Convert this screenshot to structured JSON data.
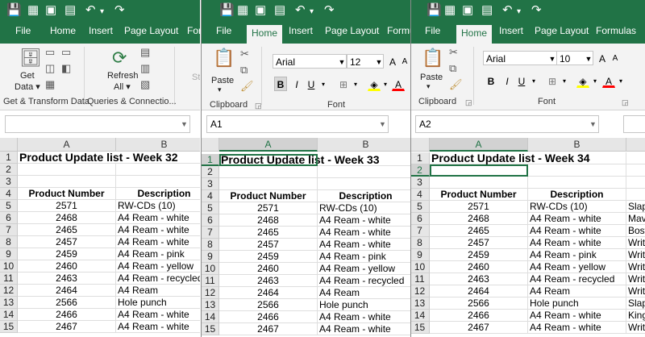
{
  "windows": [
    {
      "id": "w1",
      "qat": [
        {
          "name": "save-icon",
          "glyph": "💾"
        },
        {
          "name": "form-icon",
          "glyph": "▦"
        },
        {
          "name": "camera-icon",
          "glyph": "▣"
        },
        {
          "name": "customize-icon",
          "glyph": "▤"
        },
        {
          "name": "undo-icon",
          "glyph": "↶"
        },
        {
          "name": "undo-dropdown-icon",
          "glyph": "▾"
        },
        {
          "name": "redo-icon",
          "glyph": "↷"
        }
      ],
      "tabs": [
        {
          "label": "File",
          "active": false
        },
        {
          "label": "Home",
          "active": false
        },
        {
          "label": "Insert",
          "active": false
        },
        {
          "label": "Page Layout",
          "active": false
        },
        {
          "label": "Formu",
          "active": false
        }
      ],
      "ribbon": {
        "get_data_line1": "Get",
        "get_data_line2": "Data ▾",
        "refresh_line1": "Refresh",
        "refresh_line2": "All ▾",
        "stock_partial": "St",
        "group1": "Get & Transform Data",
        "group2": "Queries & Connectio..."
      },
      "name_box": "",
      "columns": [
        "A",
        "B"
      ],
      "title": "Product Update list - Week 32"
    },
    {
      "id": "w2",
      "qat": [
        {
          "name": "save-icon",
          "glyph": "💾"
        },
        {
          "name": "form-icon",
          "glyph": "▦"
        },
        {
          "name": "camera-icon",
          "glyph": "▣"
        },
        {
          "name": "customize-icon",
          "glyph": "▤"
        },
        {
          "name": "undo-icon",
          "glyph": "↶"
        },
        {
          "name": "undo-dropdown-icon",
          "glyph": "▾"
        },
        {
          "name": "redo-icon",
          "glyph": "↷"
        }
      ],
      "tabs": [
        {
          "label": "File",
          "active": false
        },
        {
          "label": "Home",
          "active": true
        },
        {
          "label": "Insert",
          "active": false
        },
        {
          "label": "Page Layout",
          "active": false
        },
        {
          "label": "Formu",
          "active": false
        }
      ],
      "ribbon": {
        "paste": "Paste",
        "paste_arrow": "▾",
        "font_name": "Arial",
        "font_size": "12",
        "clipboard": "Clipboard",
        "font": "Font"
      },
      "name_box": "A1",
      "columns": [
        "A",
        "B"
      ],
      "title": "Product Update list - Week 33"
    },
    {
      "id": "w3",
      "qat": [
        {
          "name": "save-icon",
          "glyph": "💾"
        },
        {
          "name": "form-icon",
          "glyph": "▦"
        },
        {
          "name": "camera-icon",
          "glyph": "▣"
        },
        {
          "name": "customize-icon",
          "glyph": "▤"
        },
        {
          "name": "undo-icon",
          "glyph": "↶"
        },
        {
          "name": "undo-dropdown-icon",
          "glyph": "▾"
        },
        {
          "name": "redo-icon",
          "glyph": "↷"
        }
      ],
      "tabs": [
        {
          "label": "File",
          "active": false
        },
        {
          "label": "Home",
          "active": true
        },
        {
          "label": "Insert",
          "active": false
        },
        {
          "label": "Page Layout",
          "active": false
        },
        {
          "label": "Formulas",
          "active": false
        }
      ],
      "ribbon": {
        "paste": "Paste",
        "paste_arrow": "▾",
        "font_name": "Arial",
        "font_size": "10",
        "clipboard": "Clipboard",
        "font": "Font"
      },
      "name_box": "A2",
      "columns": [
        "A",
        "B"
      ],
      "title": "Product Update list - Week 34"
    }
  ],
  "table_headers": {
    "product": "Product Number",
    "description": "Description"
  },
  "rows": [
    {
      "num": "2571",
      "desc": "RW-CDs (10)",
      "c": "Slap"
    },
    {
      "num": "2468",
      "desc": "A4 Ream - white",
      "c": "Mavi"
    },
    {
      "num": "2465",
      "desc": "A4 Ream - white",
      "c": "Bost"
    },
    {
      "num": "2457",
      "desc": "A4 Ream - white",
      "c": "Writ"
    },
    {
      "num": "2459",
      "desc": "A4 Ream - pink",
      "c": "Writ"
    },
    {
      "num": "2460",
      "desc": "A4 Ream - yellow",
      "c": "Writ"
    },
    {
      "num": "2463",
      "desc": "A4 Ream - recycled",
      "c": "Writ"
    },
    {
      "num": "2464",
      "desc": "A4 Ream",
      "c": "Writ"
    },
    {
      "num": "2566",
      "desc": "Hole punch",
      "c": "Slap"
    },
    {
      "num": "2466",
      "desc": "A4 Ream - white",
      "c": "King"
    },
    {
      "num": "2467",
      "desc": "A4 Ream - white",
      "c": "Writ"
    }
  ],
  "row_numbers": [
    "1",
    "2",
    "3",
    "4",
    "5",
    "6",
    "7",
    "8",
    "9",
    "10",
    "11",
    "12",
    "13",
    "14",
    "15"
  ],
  "colors": {
    "excel_green": "#217346",
    "ribbon_bg": "#f3f3f3",
    "header_bg": "#e6e6e6"
  }
}
